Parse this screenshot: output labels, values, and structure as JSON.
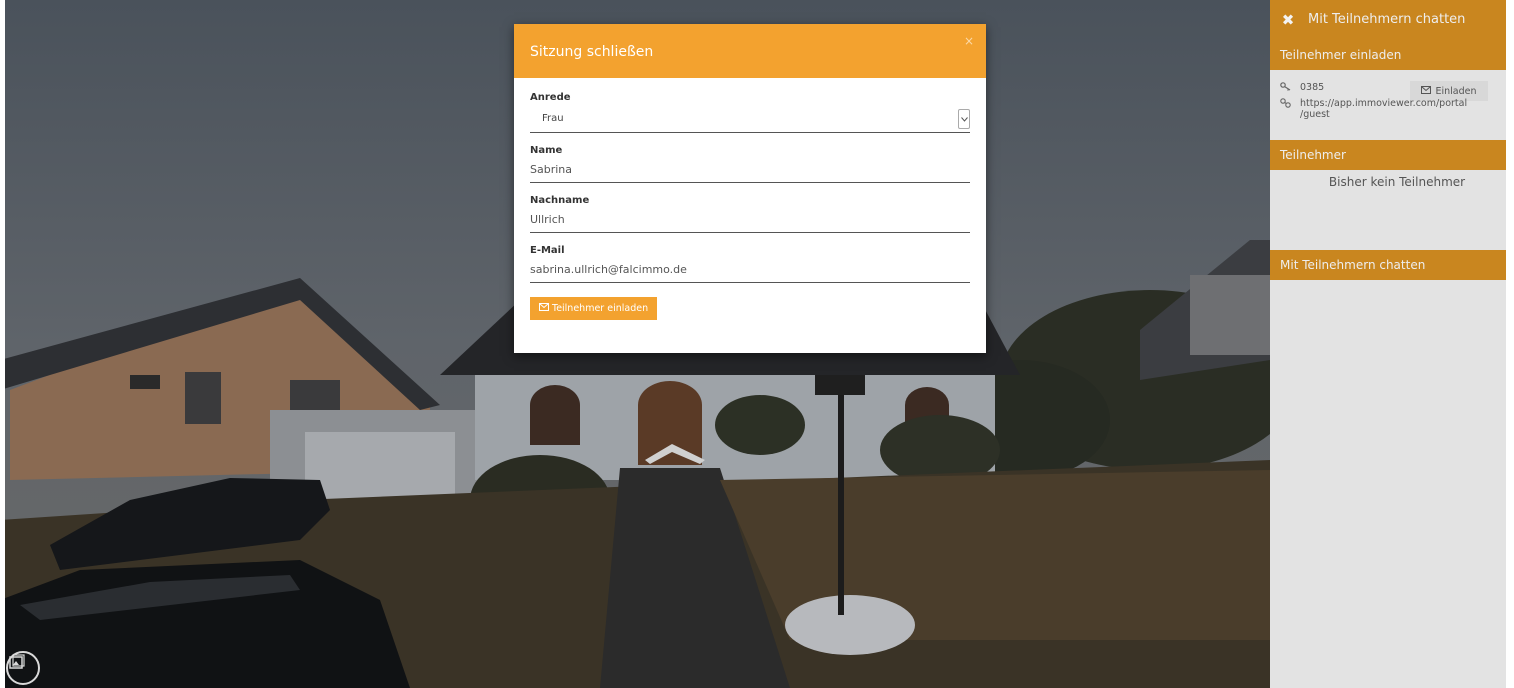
{
  "modal": {
    "title": "Sitzung schließen",
    "close_glyph": "×",
    "fields": {
      "salutation": {
        "label": "Anrede",
        "value": "Frau"
      },
      "first_name": {
        "label": "Name",
        "value": "Sabrina"
      },
      "last_name": {
        "label": "Nachname",
        "value": "Ullrich"
      },
      "email": {
        "label": "E-Mail",
        "value": "sabrina.ullrich@falcimmo.de"
      }
    },
    "submit_label": "Teilnehmer einladen"
  },
  "sidebar": {
    "header_title": "Mit Teilnehmern chatten",
    "close_glyph": "✖",
    "invite_section": {
      "title": "Teilnehmer einladen",
      "pin": "0385",
      "url_line1": "https://app.immoviewer.com/portal",
      "url_line2": "/guest",
      "invite_button": "Einladen"
    },
    "participants_section": {
      "title": "Teilnehmer",
      "empty_text": "Bisher kein Teilnehmer"
    },
    "chat_section": {
      "title": "Mit Teilnehmern chatten"
    }
  },
  "colors": {
    "accent": "#f3a22f",
    "sidebar_bar": "#c9861f",
    "sidebar_bg": "#e3e3e3"
  }
}
